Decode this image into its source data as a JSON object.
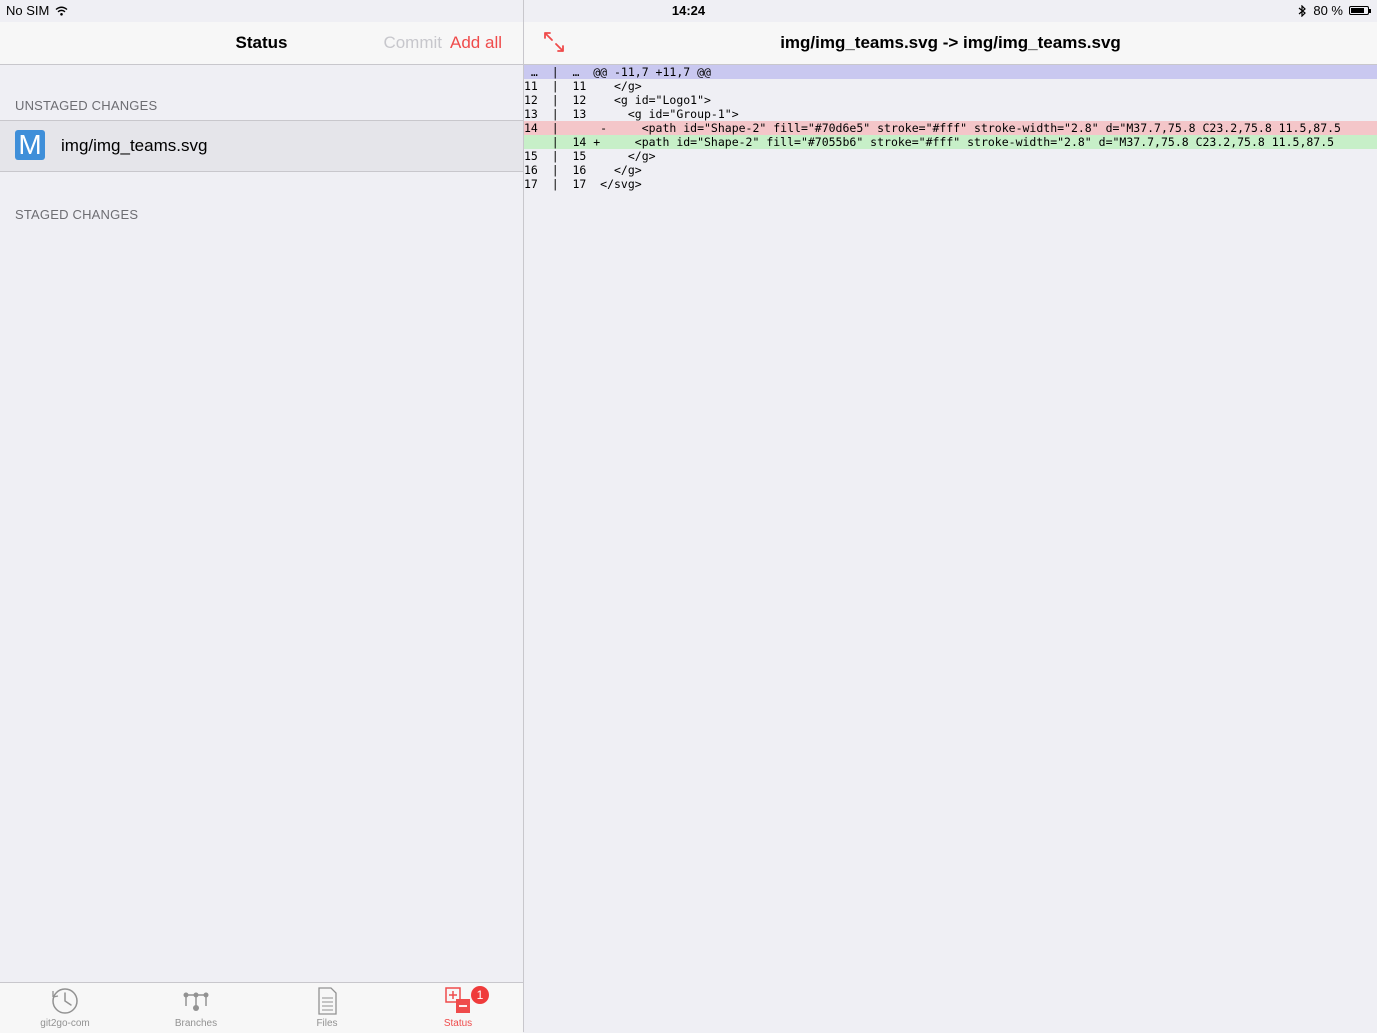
{
  "status_bar": {
    "carrier": "No SIM",
    "time": "14:24",
    "battery_text": "80 %",
    "battery_level": 0.8
  },
  "left_nav": {
    "title": "Status",
    "commit_label": "Commit",
    "add_all_label": "Add all"
  },
  "sections": {
    "unstaged_header": "UNSTAGED CHANGES",
    "staged_header": "STAGED CHANGES"
  },
  "unstaged_files": [
    {
      "status": "M",
      "name": "img/img_teams.svg"
    }
  ],
  "tabs": [
    {
      "label": "git2go-com",
      "icon": "clock-icon",
      "active": false
    },
    {
      "label": "Branches",
      "icon": "branches-icon",
      "active": false
    },
    {
      "label": "Files",
      "icon": "document-icon",
      "active": false
    },
    {
      "label": "Status",
      "icon": "status-plus-minus-icon",
      "active": true,
      "badge": "1"
    }
  ],
  "right_nav": {
    "title": "img/img_teams.svg -> img/img_teams.svg",
    "expand_icon": "expand-icon"
  },
  "diff_lines": [
    {
      "type": "hunk",
      "text": " …  |  …  @@ -11,7 +11,7 @@"
    },
    {
      "type": "ctx",
      "text": "11  |  11    </g>"
    },
    {
      "type": "ctx",
      "text": "12  |  12    <g id=\"Logo1\">"
    },
    {
      "type": "ctx",
      "text": "13  |  13      <g id=\"Group-1\">"
    },
    {
      "type": "del",
      "text": "14  |      -     <path id=\"Shape-2\" fill=\"#70d6e5\" stroke=\"#fff\" stroke-width=\"2.8\" d=\"M37.7,75.8 C23.2,75.8 11.5,87.5"
    },
    {
      "type": "add",
      "text": "    |  14 +     <path id=\"Shape-2\" fill=\"#7055b6\" stroke=\"#fff\" stroke-width=\"2.8\" d=\"M37.7,75.8 C23.2,75.8 11.5,87.5"
    },
    {
      "type": "ctx",
      "text": "15  |  15      </g>"
    },
    {
      "type": "ctx",
      "text": "16  |  16    </g>"
    },
    {
      "type": "ctx",
      "text": "17  |  17  </svg>"
    }
  ],
  "colors": {
    "accent": "#ef4b4b",
    "status_m": "#3f8fd9",
    "hunk_bg": "#c9c8f0",
    "del_bg": "#f4c6c9",
    "add_bg": "#c7efc8"
  }
}
